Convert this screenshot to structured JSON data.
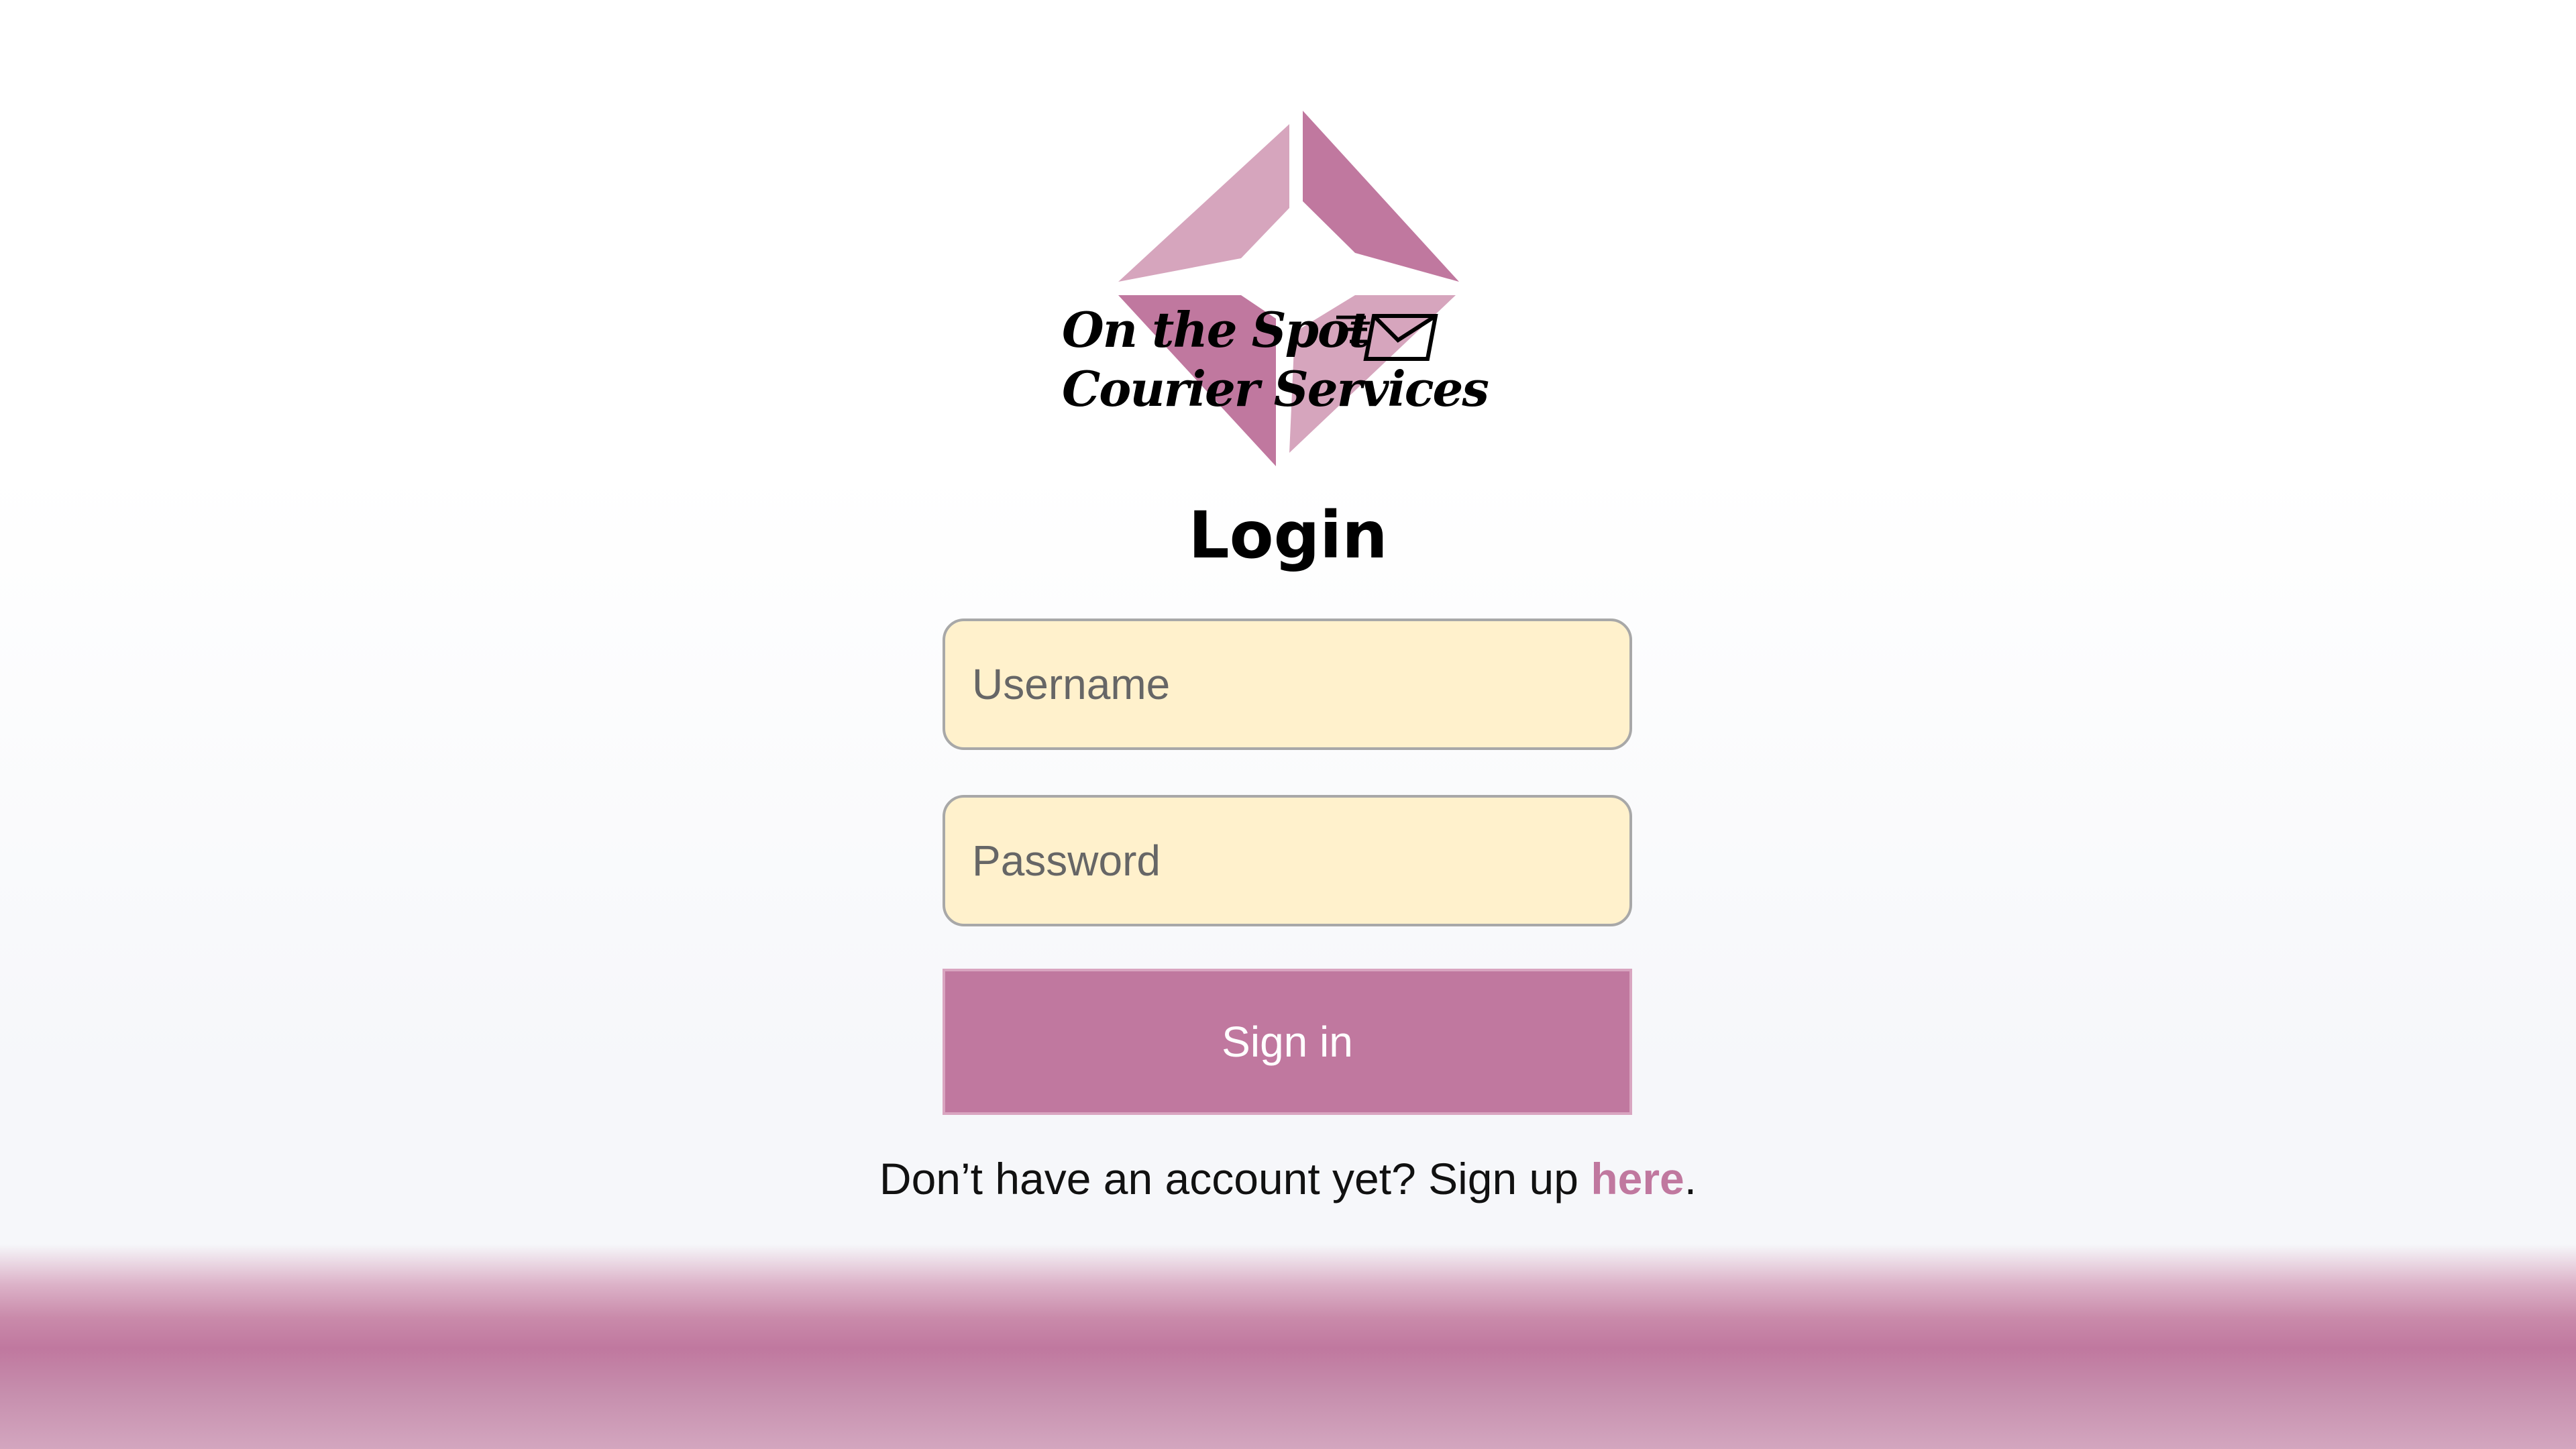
{
  "brand": {
    "name_line1": "On the Spot",
    "name_line2": "Courier Services",
    "logo_colors": [
      "#d6a5bd",
      "#c0789f"
    ]
  },
  "page": {
    "title": "Login"
  },
  "form": {
    "username_placeholder": "Username",
    "password_placeholder": "Password",
    "submit_label": "Sign in"
  },
  "signup": {
    "prompt": "Don’t have an account yet? Sign up ",
    "link_text": "here",
    "suffix": "."
  },
  "colors": {
    "accent": "#c0789f",
    "input_background": "#fff1cc",
    "input_border": "#a8a8a8"
  },
  "icons": {
    "logo": "diamond-logo-icon",
    "envelope": "envelope-icon"
  }
}
